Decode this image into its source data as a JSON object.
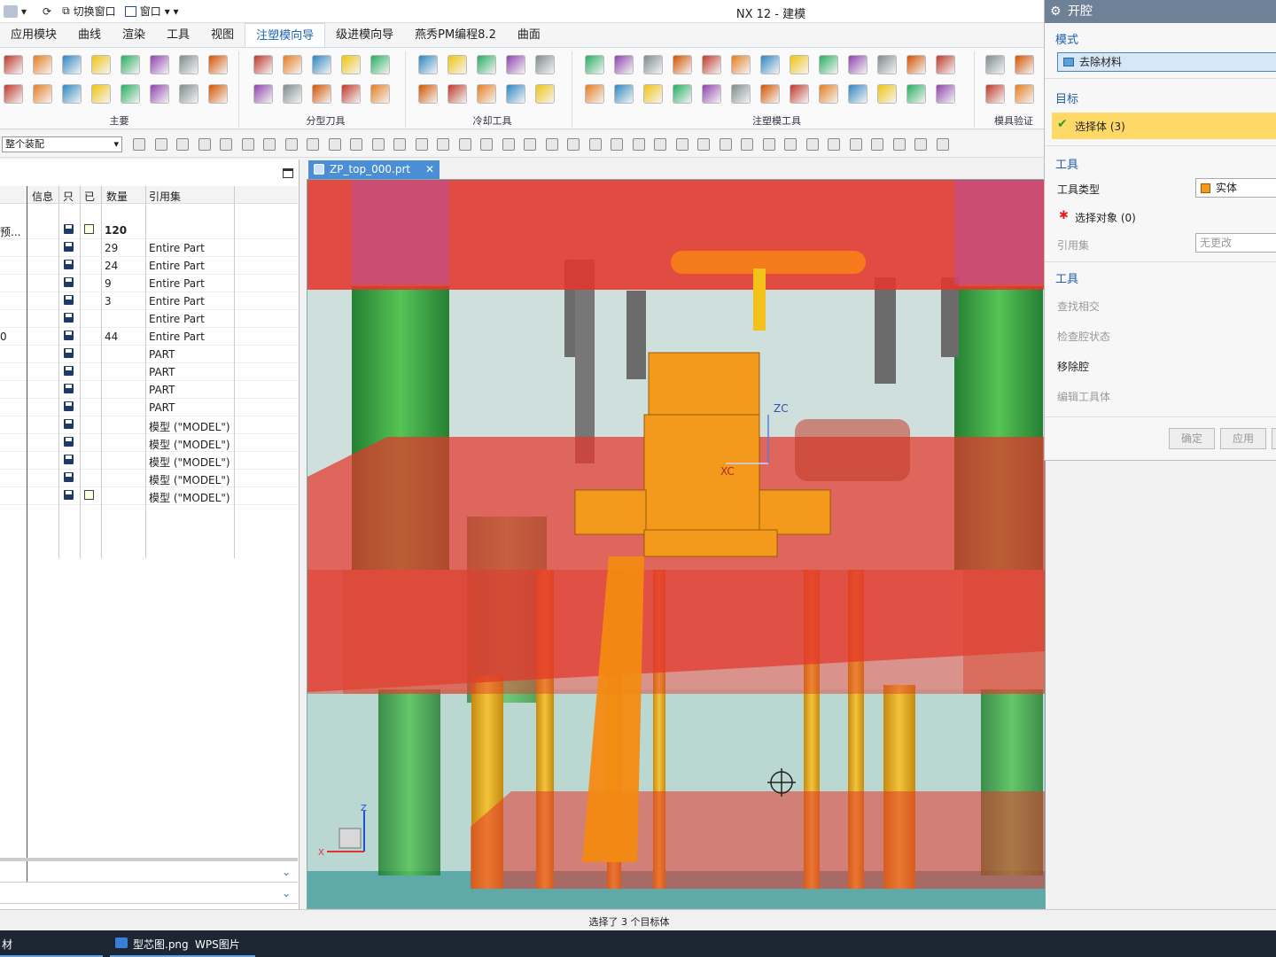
{
  "window": {
    "title": "NX 12 - 建模",
    "switch_window": "切换窗口",
    "window_menu": "窗口"
  },
  "menu": {
    "tabs": [
      "应用模块",
      "曲线",
      "渲染",
      "工具",
      "视图",
      "注塑模向导",
      "级进模向导",
      "燕秀PM编程8.2",
      "曲面"
    ],
    "active_index": 5
  },
  "ribbon": {
    "groups": [
      "主要",
      "分型刀具",
      "冷却工具",
      "注塑模工具",
      "模具验证"
    ]
  },
  "toolbar": {
    "assembly_filter": "整个装配"
  },
  "document_tab": {
    "label": "ZP_top_000.prt"
  },
  "navigator": {
    "columns": [
      "信息",
      "只",
      "已",
      "数量",
      "引用集"
    ],
    "rows": [
      {
        "name": "预...",
        "qty": "120",
        "refset": "",
        "edit": true
      },
      {
        "name": "",
        "qty": "29",
        "refset": "Entire Part"
      },
      {
        "name": "",
        "qty": "24",
        "refset": "Entire Part"
      },
      {
        "name": "",
        "qty": "9",
        "refset": "Entire Part"
      },
      {
        "name": "",
        "qty": "3",
        "refset": "Entire Part"
      },
      {
        "name": "",
        "qty": "",
        "refset": "Entire Part"
      },
      {
        "name": "0",
        "qty": "44",
        "refset": "Entire Part"
      },
      {
        "name": "",
        "qty": "",
        "refset": "PART"
      },
      {
        "name": "",
        "qty": "",
        "refset": "PART"
      },
      {
        "name": "",
        "qty": "",
        "refset": "PART"
      },
      {
        "name": "",
        "qty": "",
        "refset": "PART"
      },
      {
        "name": "",
        "qty": "",
        "refset": "模型 (\"MODEL\")"
      },
      {
        "name": "",
        "qty": "",
        "refset": "模型 (\"MODEL\")"
      },
      {
        "name": "",
        "qty": "",
        "refset": "模型 (\"MODEL\")"
      },
      {
        "name": "",
        "qty": "",
        "refset": "模型 (\"MODEL\")"
      },
      {
        "name": "",
        "qty": "",
        "refset": "模型 (\"MODEL\")",
        "edit": true
      }
    ]
  },
  "viewport": {
    "triad": {
      "x": "X",
      "z": "Z"
    },
    "axis_labels": {
      "xc": "XC",
      "zc": "ZC"
    }
  },
  "dialog": {
    "title": "开腔",
    "mode_header": "模式",
    "mode_value": "去除材料",
    "target_header": "目标",
    "target_value": "选择体 (3)",
    "tool_header": "工具",
    "tool_type_label": "工具类型",
    "tool_type_value": "实体",
    "select_object": "选择对象 (0)",
    "refset_label": "引用集",
    "refset_value": "无更改",
    "tool2_header": "工具",
    "find_intersect": "查找相交",
    "check_cavity": "检查腔状态",
    "remove_cavity": "移除腔",
    "edit_tool": "编辑工具体",
    "ok": "确定",
    "apply": "应用"
  },
  "status": {
    "message": "选择了 3 个目标体"
  },
  "taskbar": {
    "left_item": "材",
    "app_item": "型芯图.png",
    "app_name": "WPS图片"
  },
  "colors": {
    "accent": "#1e64b4",
    "dialog_title": "#6f8196",
    "target_highlight": "#ffd966",
    "mold_red": "#e0302a",
    "mold_green": "#2f9a3a",
    "mold_orange": "#f39a1d"
  }
}
